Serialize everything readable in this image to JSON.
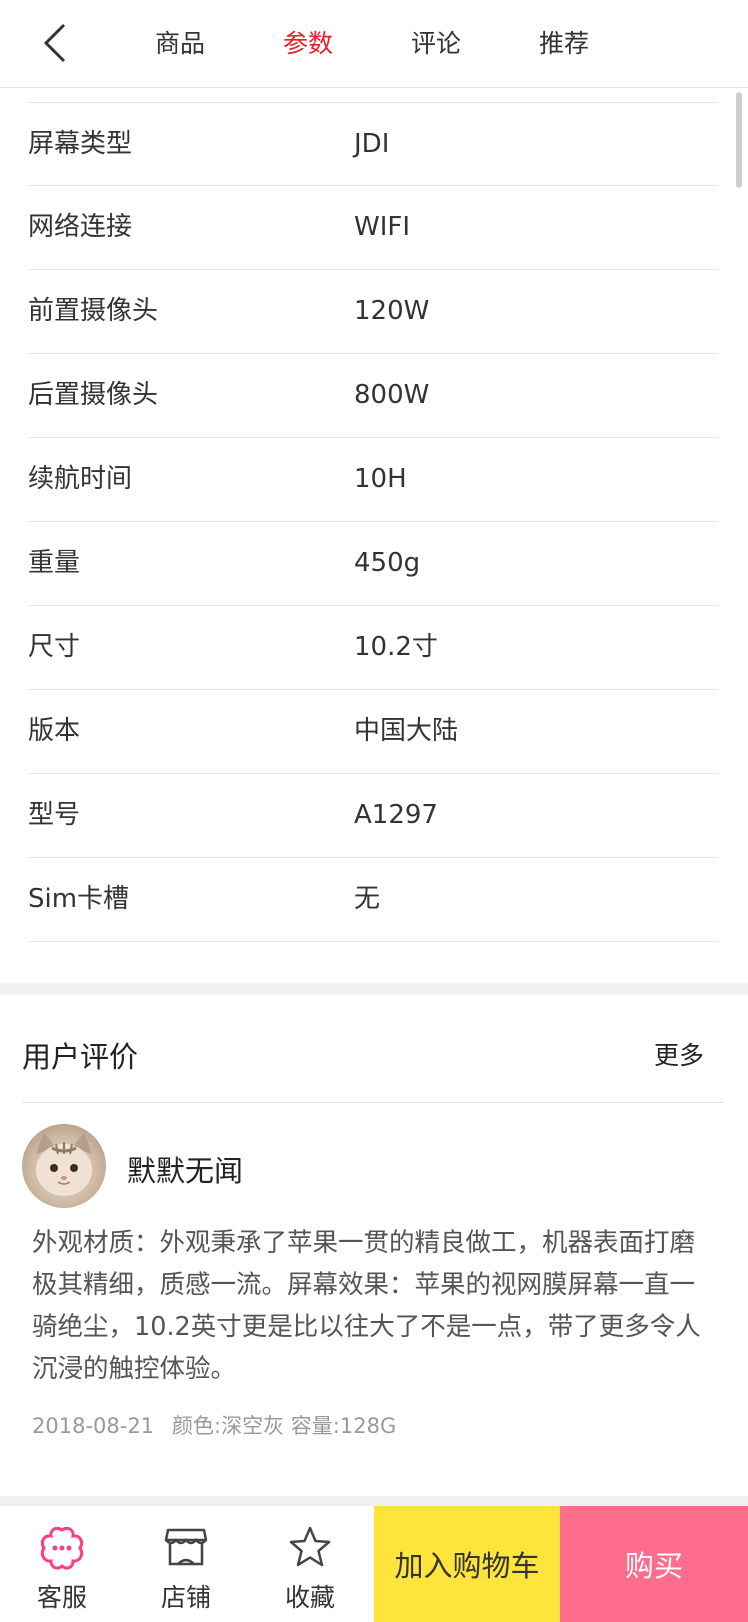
{
  "nav": {
    "tabs": [
      {
        "label": "商品"
      },
      {
        "label": "参数"
      },
      {
        "label": "评论"
      },
      {
        "label": "推荐"
      }
    ],
    "active_color": "#e8202a"
  },
  "params": [
    {
      "key": "屏幕类型",
      "value": "JDI"
    },
    {
      "key": "网络连接",
      "value": "WIFI"
    },
    {
      "key": "前置摄像头",
      "value": "120W"
    },
    {
      "key": "后置摄像头",
      "value": "800W"
    },
    {
      "key": "续航时间",
      "value": "10H"
    },
    {
      "key": "重量",
      "value": "450g"
    },
    {
      "key": "尺寸",
      "value": "10.2寸"
    },
    {
      "key": "版本",
      "value": "中国大陆"
    },
    {
      "key": "型号",
      "value": "A1297"
    },
    {
      "key": "Sim卡槽",
      "value": "无"
    }
  ],
  "review": {
    "section_title": "用户评价",
    "more_label": "更多",
    "username": "默默无闻",
    "text": "外观材质：外观秉承了苹果一贯的精良做工，机器表面打磨极其精细，质感一流。屏幕效果：苹果的视网膜屏幕一直一骑绝尘，10.2英寸更是比以往大了不是一点，带了更多令人沉浸的触控体验。",
    "date": "2018-08-21",
    "spec": "颜色:深空灰 容量:128G"
  },
  "bottom": {
    "service_label": "客服",
    "shop_label": "店铺",
    "favorite_label": "收藏",
    "cart_label": "加入购物车",
    "buy_label": "购买",
    "service_icon_color": "#ff3d7f",
    "cart_color": "#ffe53b",
    "buy_color": "#ff6d8c"
  }
}
